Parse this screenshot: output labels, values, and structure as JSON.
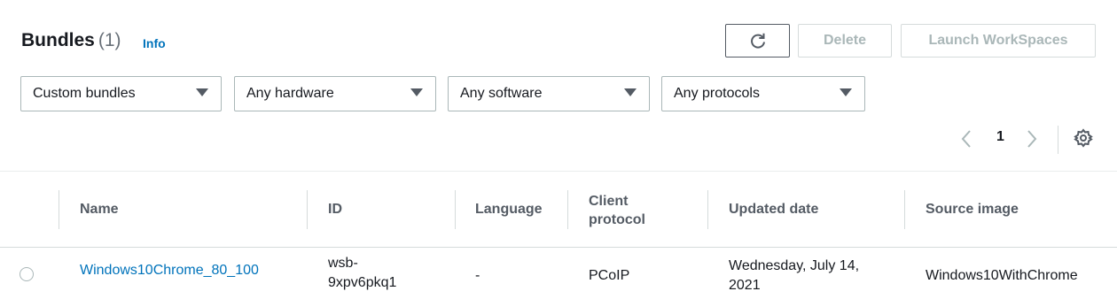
{
  "header": {
    "title": "Bundles",
    "count": "(1)",
    "info_label": "Info"
  },
  "actions": {
    "refresh_icon": "refresh-icon",
    "delete_label": "Delete",
    "launch_label": "Launch WorkSpaces"
  },
  "filters": [
    {
      "value": "Custom bundles"
    },
    {
      "value": "Any hardware"
    },
    {
      "value": "Any software"
    },
    {
      "value": "Any protocols"
    }
  ],
  "pagination": {
    "current_page": "1"
  },
  "table": {
    "columns": [
      "Name",
      "ID",
      "Language",
      "Client protocol",
      "Updated date",
      "Source image"
    ],
    "rows": [
      {
        "name": "Windows10Chrome_80_100",
        "id": "wsb-9xpv6pkq1",
        "language": "-",
        "client_protocol": "PCoIP",
        "updated_date": "Wednesday, July 14, 2021",
        "source_image": "Windows10WithChrome"
      }
    ]
  },
  "colors": {
    "link": "#0073bb",
    "border": "#aab7b8",
    "disabled_text": "#aab7b8",
    "header_text": "#545b64"
  }
}
